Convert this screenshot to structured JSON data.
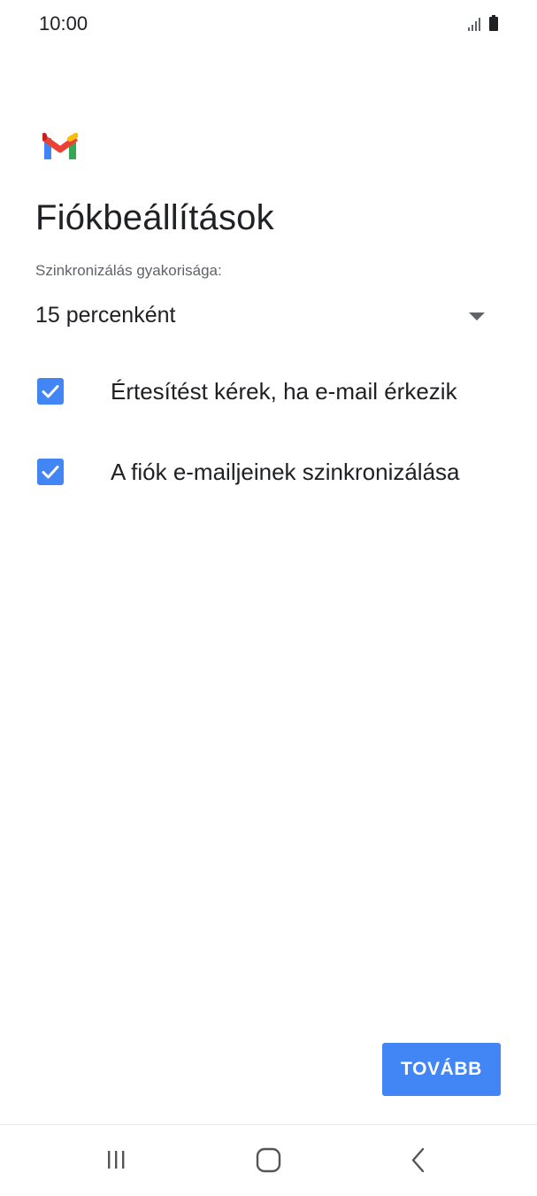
{
  "status_bar": {
    "time": "10:00",
    "icons": [
      "signal-icon",
      "battery-icon"
    ]
  },
  "app": {
    "logo_icon": "gmail-logo-icon",
    "colors": {
      "red": "#EA4335",
      "blue": "#4285F4",
      "green": "#34A853",
      "yellow": "#FBBC05"
    }
  },
  "page": {
    "title": "Fiókbeállítások",
    "sync_frequency": {
      "label": "Szinkronizálás gyakorisága:",
      "value": "15 percenként"
    },
    "options": [
      {
        "label": "Értesítést kérek, ha e-mail érkezik",
        "checked": true
      },
      {
        "label": "A fiók e-mailjeinek szinkronizálása",
        "checked": true
      }
    ],
    "next_label": "TOVÁBB"
  },
  "nav_bar": {
    "icons": [
      "recent-apps-icon",
      "home-icon",
      "back-icon"
    ]
  },
  "accent_color": "#4285F4"
}
